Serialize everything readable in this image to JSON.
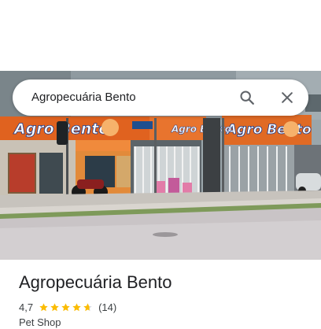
{
  "search": {
    "query": "Agropecuária Bento",
    "search_icon": "search-icon",
    "close_icon": "close-icon"
  },
  "photo": {
    "sign_text": "Agro Bento"
  },
  "place": {
    "name": "Agropecuária Bento",
    "rating": "4,7",
    "rating_value": 4.7,
    "stars_total": 5,
    "review_count": "(14)",
    "category": "Pet Shop",
    "star_color": "#fbbc04",
    "star_empty_color": "#dadce0"
  }
}
